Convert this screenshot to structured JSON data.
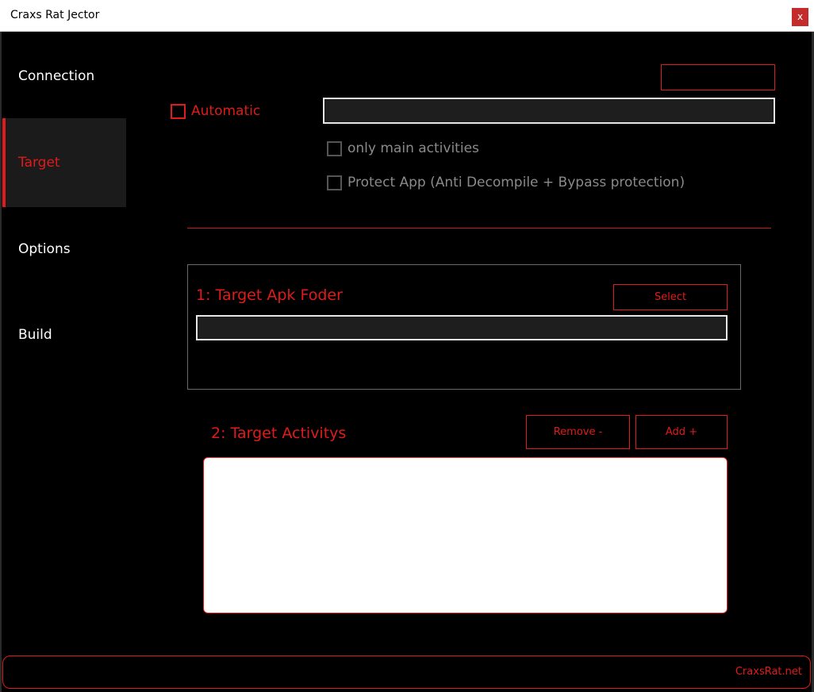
{
  "window": {
    "title": "Craxs Rat Jector",
    "close_label": "x"
  },
  "sidebar": {
    "items": [
      {
        "label": "Connection",
        "active": false
      },
      {
        "label": "Target",
        "active": true
      },
      {
        "label": "Options",
        "active": false
      },
      {
        "label": "Build",
        "active": false
      }
    ]
  },
  "target": {
    "automatic_label": "Automatic",
    "automatic_checked": false,
    "activity_input_value": "",
    "only_main_label": "only main activities",
    "protect_label": "Protect App (Anti Decompile + Bypass protection)"
  },
  "apk_folder": {
    "title": "1: Target Apk Foder",
    "select_label": "Select",
    "path_value": ""
  },
  "activities": {
    "title": "2: Target Activitys",
    "remove_label": "Remove -",
    "add_label": "Add +",
    "items": []
  },
  "footer": {
    "brand": "CraxsRat.net"
  },
  "colors": {
    "accent": "#e01b1b",
    "background": "#000000",
    "panel": "#1b1b1b"
  }
}
